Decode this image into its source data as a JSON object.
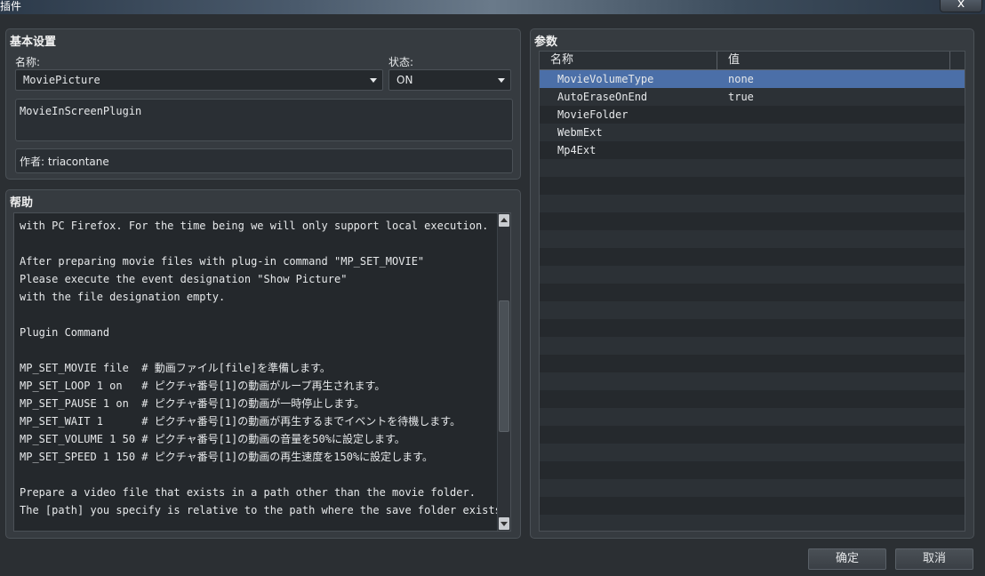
{
  "window": {
    "title": "插件",
    "close_label": "x"
  },
  "basic": {
    "title": "基本设置",
    "name_label": "名称:",
    "name_value": "MoviePicture",
    "status_label": "状态:",
    "status_value": "ON",
    "description": "MovieInScreenPlugin",
    "author": "作者: triacontane"
  },
  "help": {
    "title": "帮助",
    "lines": [
      "with PC Firefox. For the time being we will only support local execution.",
      "",
      "After preparing movie files with plug-in command \"MP_SET_MOVIE\"",
      "Please execute the event designation \"Show Picture\"",
      "with the file designation empty.",
      "",
      "Plugin Command",
      "",
      "MP_SET_MOVIE file  # 動画ファイル[file]を準備します。",
      "MP_SET_LOOP 1 on   # ピクチャ番号[1]の動画がループ再生されます。",
      "MP_SET_PAUSE 1 on  # ピクチャ番号[1]の動画が一時停止します。",
      "MP_SET_WAIT 1      # ピクチャ番号[1]の動画が再生するまでイベントを待機します。",
      "MP_SET_VOLUME 1 50 # ピクチャ番号[1]の動画の音量を50%に設定します。",
      "MP_SET_SPEED 1 150 # ピクチャ番号[1]の動画の再生速度を150%に設定します。",
      "",
      "Prepare a video file that exists in a path other than the movie folder.",
      "The [path] you specify is relative to the path where the save folder exists."
    ]
  },
  "params": {
    "title": "参数",
    "columns": [
      "名称",
      "值"
    ],
    "rows": [
      {
        "name": "MovieVolumeType",
        "value": "none",
        "selected": true
      },
      {
        "name": "AutoEraseOnEnd",
        "value": "true"
      },
      {
        "name": "MovieFolder",
        "value": ""
      },
      {
        "name": "WebmExt",
        "value": ""
      },
      {
        "name": "Mp4Ext",
        "value": ""
      }
    ]
  },
  "buttons": {
    "ok": "确定",
    "cancel": "取消"
  },
  "colors": {
    "selection": "#4b6fa8",
    "panel": "#363b40",
    "background": "#2b2f33"
  }
}
